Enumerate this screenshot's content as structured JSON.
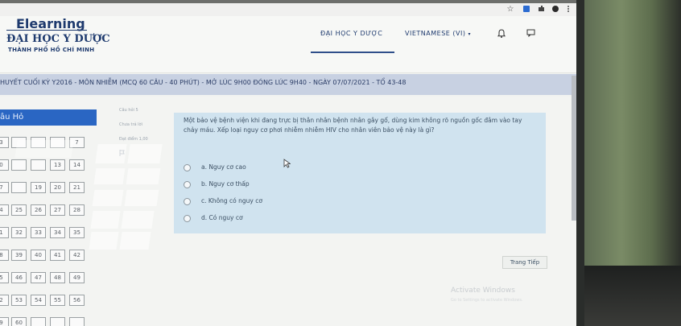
{
  "header": {
    "logo_line1": "Elearning",
    "logo_line2": "ĐẠI HỌC Y DƯỢC",
    "logo_line3": "THÀNH PHỐ HỒ CHÍ MINH",
    "nav_school": "ĐẠI HỌC Y DƯỢC",
    "nav_language": "VIETNAMESE (VI)",
    "language_caret": "▾",
    "bell_icon": "🔔",
    "chat_icon": "▭"
  },
  "browser": {
    "star_icon": "☆"
  },
  "quiz": {
    "title": "HUYẾT CUỐI KỲ Y2016 - MÔN NHIỄM (MCQ 60 CÂU - 40 PHÚT) - MỞ LÚC 9H00 ĐÓNG LÚC 9H40 - NGÀY 07/07/2021 - TỔ 43-48",
    "nav_heading": "âu Hỏ",
    "question_numbers": [
      [
        "3",
        "",
        "",
        "",
        "7"
      ],
      [
        "0",
        "",
        "",
        "13",
        "14"
      ],
      [
        "7",
        "",
        "19",
        "20",
        "21"
      ],
      [
        "4",
        "25",
        "26",
        "27",
        "28"
      ],
      [
        "1",
        "32",
        "33",
        "34",
        "35"
      ],
      [
        "8",
        "39",
        "40",
        "41",
        "42"
      ],
      [
        "5",
        "46",
        "47",
        "48",
        "49"
      ],
      [
        "2",
        "53",
        "54",
        "55",
        "56"
      ],
      [
        "9",
        "60",
        "",
        "",
        ""
      ]
    ],
    "info_question": "Câu hỏi 5",
    "info_status": "Chưa trả lời",
    "info_points": "Đạt điểm 1,00",
    "question_text": "Một bảo vệ bệnh viện khi đang trực bị thân nhân bệnh nhân gây gổ, dùng kim không rõ nguồn gốc đâm vào tay chảy máu. Xếp loại nguy cơ phơi nhiễm nhiễm HIV cho nhân viên bảo vệ này là gì?",
    "options": [
      "a. Nguy cơ cao",
      "b. Nguy cơ thấp",
      "c. Không có nguy cơ",
      "d. Có nguy cơ"
    ],
    "next_button": "Trang Tiếp"
  },
  "os": {
    "activate_title": "Activate Windows",
    "activate_sub": "Go to Settings to activate Windows."
  }
}
